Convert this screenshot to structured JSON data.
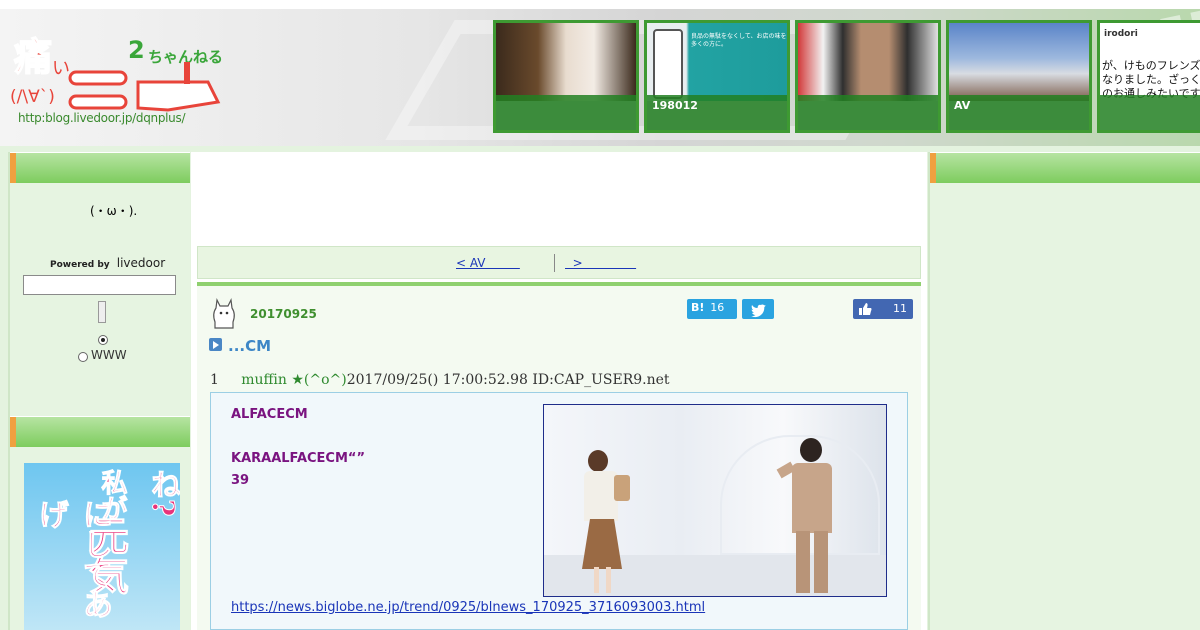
{
  "header": {
    "logo_url_text": "http:blog.livedoor.jp/dqnplus/",
    "thumbnails": [
      {
        "caption": ""
      },
      {
        "caption": "198012"
      },
      {
        "caption": ""
      },
      {
        "caption": "AV"
      },
      {
        "caption": "",
        "brand": "irodori",
        "text1": "が、けものフレンズ",
        "text2": "なりました。ざっく",
        "text3": "のお通しみたいです"
      }
    ],
    "thumb2_text": "良品の無駄をなくして、お店の味を多くの方に。"
  },
  "sidebar": {
    "face": "(・ω・).",
    "powered_label": "Powered by",
    "powered_brand": "livedoor",
    "search_value": "",
    "radio_www_label": "WWW"
  },
  "nav": {
    "prev_label": "< AV         ",
    "next_label": "  >              "
  },
  "article": {
    "date": "20170925",
    "hatebu_label": "B!",
    "hatebu_count": "16",
    "like_count": "11",
    "title": "...CM",
    "res_number": "1",
    "res_name": "muffin ★(^o^)",
    "res_meta": "2017/09/25() 17:00:52.98 ID:CAP_USER9.net",
    "body_line1": "ALFACECM",
    "body_line2": "KARAALFACECM“”",
    "body_line3": "39",
    "source_link": "https://news.biglobe.ne.jp/trend/0925/blnews_170925_3716093003.html"
  }
}
